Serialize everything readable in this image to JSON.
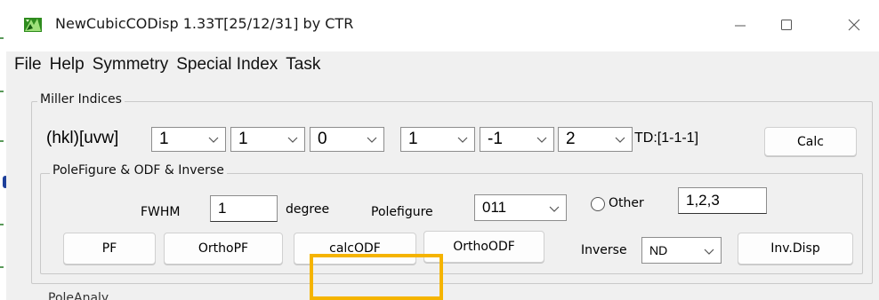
{
  "window": {
    "title": "NewCubicCODisp 1.33T[25/12/31] by CTR",
    "controls": {
      "minimize": "—",
      "maximize": "☐",
      "close": "✕"
    }
  },
  "menu": [
    "File",
    "Help",
    "Symmetry",
    "Special Index",
    "Task"
  ],
  "miller": {
    "group_label": "Miller Indices",
    "hkluvw_label": "(hkl)[uvw]",
    "hkl": [
      "1",
      "1",
      "0"
    ],
    "uvw": [
      "1",
      "-1",
      "2"
    ],
    "td_label": "TD:[1-1-1]",
    "calc_button": "Calc"
  },
  "polefigure": {
    "group_label": "PoleFigure & ODF & Inverse",
    "fwhm_label": "FWHM",
    "fwhm_value": "1",
    "degree_label": "degree",
    "polefigure_label": "Polefigure",
    "polefigure_value": "011",
    "other_label": "Other",
    "other_value": "1,2,3",
    "buttons": {
      "pf": "PF",
      "orthopf": "OrthoPF",
      "calcodf": "calcODF",
      "orthoodf": "OrthoODF",
      "invdisp": "Inv.Disp"
    },
    "inverse_label": "Inverse",
    "inverse_value": "ND"
  },
  "next_group_partial": "PoleAnaly",
  "colors": {
    "highlight": "#f5b400",
    "client_bg": "#f0f0f0",
    "icon_green": "#2e8b1e"
  }
}
